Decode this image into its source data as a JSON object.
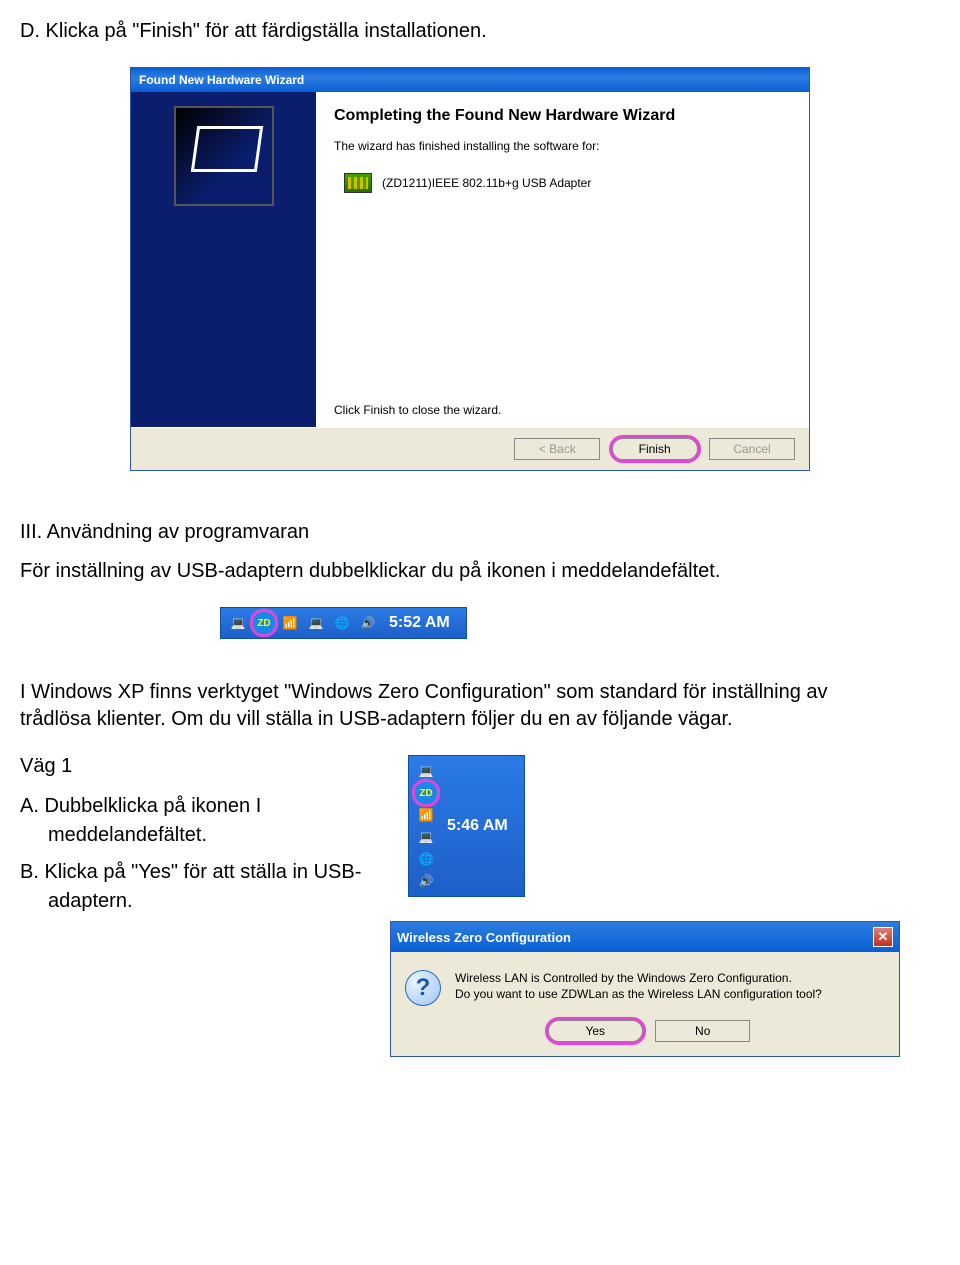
{
  "step_d": "D. Klicka på \"Finish\" för att färdigställa installationen.",
  "wizard": {
    "title": "Found New Hardware Wizard",
    "heading": "Completing the Found New Hardware Wizard",
    "installed_text": "The wizard has finished installing the software for:",
    "device_name": "(ZD1211)IEEE 802.11b+g USB Adapter",
    "close_text": "Click Finish to close the wizard.",
    "back": "< Back",
    "finish": "Finish",
    "cancel": "Cancel"
  },
  "section3_title": "III. Användning av programvaran",
  "section3_intro": "För inställning av USB-adaptern dubbelklickar du på ikonen i meddelandefältet.",
  "tray1": {
    "time": "5:52 AM",
    "zd_label": "ZD"
  },
  "para_xp": "I Windows XP finns verktyget \"Windows Zero Configuration\" som standard för inställning av trådlösa klienter. Om du vill ställa in USB-adaptern följer du en av följande vägar.",
  "way1": {
    "title": "Väg 1",
    "a": "A.  Dubbelklicka på ikonen I meddelandefältet.",
    "b": "B.  Klicka på \"Yes\" för att ställa in USB-adaptern."
  },
  "tray2": {
    "time": "5:46 AM",
    "zd_label": "ZD"
  },
  "wzc": {
    "title": "Wireless Zero Configuration",
    "line1": "Wireless LAN is Controlled by the Windows Zero Configuration.",
    "line2": "Do you want to use ZDWLan as the Wireless LAN configuration tool?",
    "yes": "Yes",
    "no": "No"
  }
}
